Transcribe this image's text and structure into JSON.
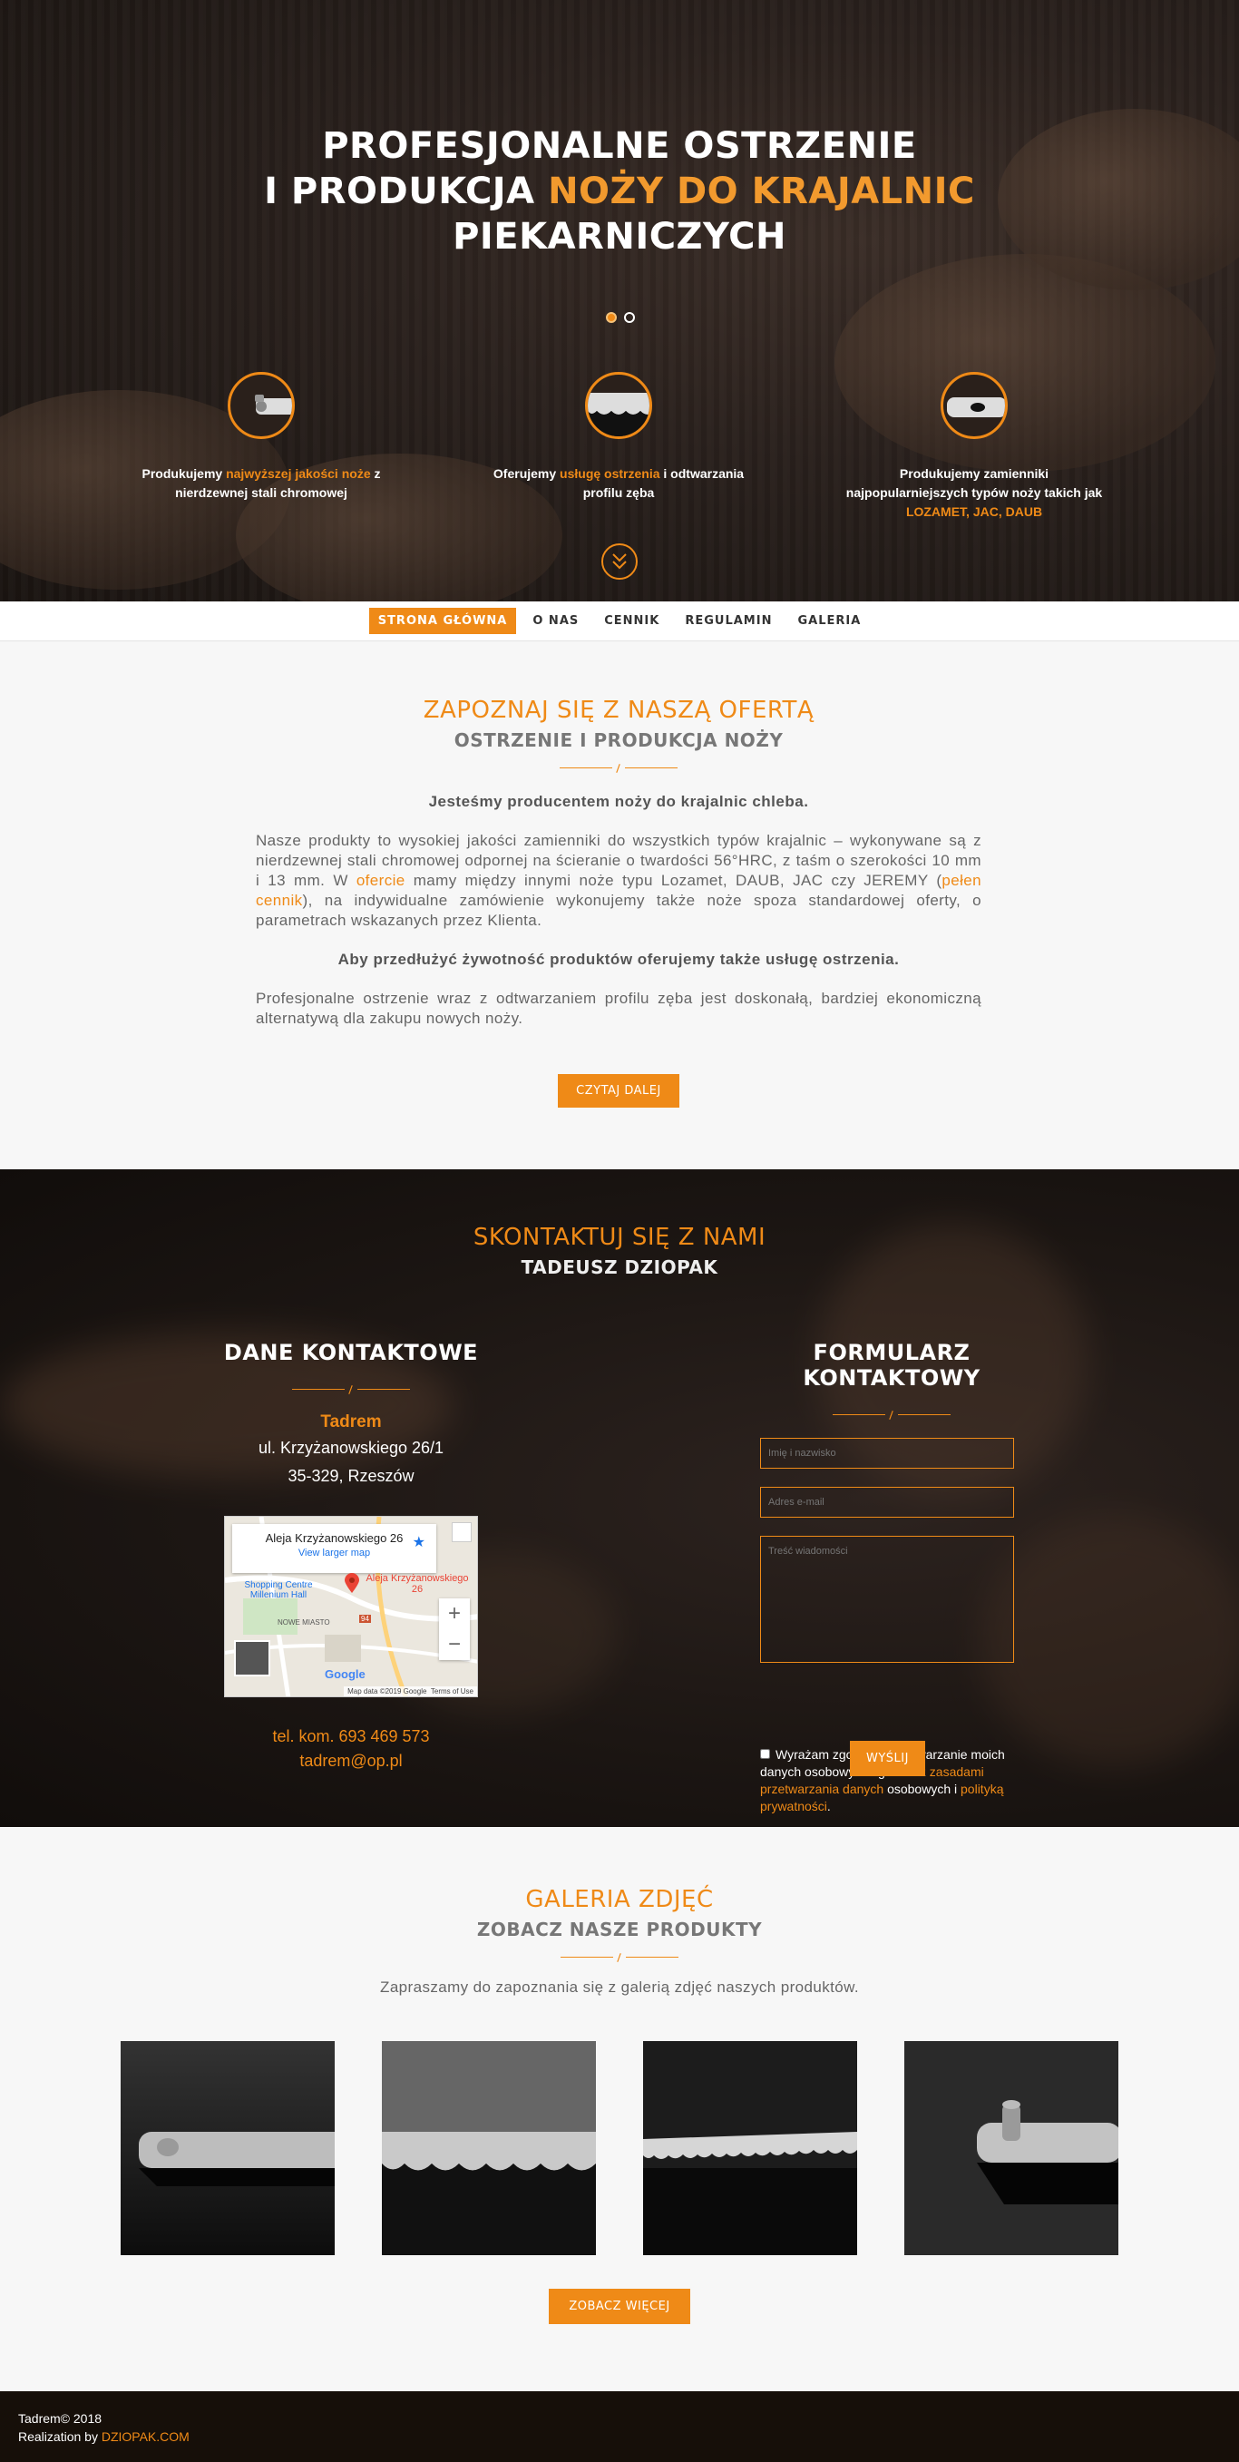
{
  "hero": {
    "title_line1": "PROFESJONALNE OSTRZENIE",
    "title_line2_prefix": "I PRODUKCJA ",
    "title_line2_highlight": "NOŻY DO KRAJALNIC",
    "title_line3": "PIEKARNICZYCH",
    "slide_count": 2,
    "active_slide": 1,
    "features": [
      {
        "icon": "knife-holder-icon",
        "pre": "Produkujemy ",
        "hl": "najwyższej jakości noże",
        "post": " z nierdzewnej stali chromowej"
      },
      {
        "icon": "serrated-blade-icon",
        "pre": "Oferujemy ",
        "hl": "usługę ostrzenia",
        "post": " i odtwarzania profilu zęba"
      },
      {
        "icon": "blade-hole-icon",
        "pre": "Produkujemy zamienniki najpopularniejszych typów noży takich jak ",
        "hl": "LOZAMET, JAC, DAUB",
        "post": ""
      }
    ]
  },
  "nav": {
    "items": [
      "STRONA GŁÓWNA",
      "O NAS",
      "CENNIK",
      "REGULAMIN",
      "GALERIA"
    ],
    "active_index": 0
  },
  "offer": {
    "title": "ZAPOZNAJ SIĘ Z NASZĄ OFERTĄ",
    "subtitle": "OSTRZENIE I PRODUKCJA NOŻY",
    "lead": "Jesteśmy producentem noży do krajalnic chleba.",
    "p1_a": "Nasze produkty to wysokiej jakości zamienniki do wszystkich typów krajalnic – wykonywane są z nierdzewnej stali chromowej odpornej na ścieranie o twardości 56°HRC, z taśm o szerokości 10 mm i 13 mm. W ",
    "p1_link1": "ofercie",
    "p1_b": " mamy między innymi noże typu Lozamet, DAUB, JAC czy JEREMY (",
    "p1_link2": "pełen cennik",
    "p1_c": "), na indywidualne zamówienie wykonujemy także noże spoza standardowej oferty, o parametrach wskazanych przez Klienta.",
    "lead2": "Aby przedłużyć żywotność produktów oferujemy także usługę ostrzenia.",
    "p2": "Profesjonalne ostrzenie wraz z odtwarzaniem profilu zęba jest doskonałą, bardziej ekonomiczną alternatywą dla zakupu nowych noży.",
    "button": "CZYTAJ DALEJ"
  },
  "contact": {
    "title": "SKONTAKTUJ SIĘ Z NAMI",
    "subtitle": "TADEUSZ DZIOPAK",
    "left_title": "DANE KONTAKTOWE",
    "company": "Tadrem",
    "street": "ul. Krzyżanowskiego 26/1",
    "city": "35-329, Rzeszów",
    "map": {
      "place": "Aleja Krzyżanowskiego 26",
      "larger": "View larger map",
      "pin_label": "Aleja Krzyżanowskiego 26",
      "poi1": "Shopping Centre Millenium Hall",
      "district": "NOWE MIASTO",
      "road": "94",
      "footer1": "Map data ©2019 Google",
      "footer2": "Terms of Use",
      "logo": "Google"
    },
    "phone": "tel. kom. 693 469 573",
    "email": "tadrem@op.pl",
    "right_title": "FORMULARZ KONTAKTOWY",
    "name_placeholder": "Imię i nazwisko",
    "email_placeholder": "Adres e-mail",
    "message_placeholder": "Treść wiadomości",
    "consent_a": "Wyrażam zgodę na przetwarzanie moich danych osobowych zgodnie z ",
    "consent_link1": "zasadami przetwarzania danych",
    "consent_b": " osobowych i ",
    "consent_link2": "polityką prywatności",
    "consent_c": ".",
    "submit": "WYŚLIJ"
  },
  "gallery": {
    "title": "GALERIA ZDJĘĆ",
    "subtitle": "ZOBACZ NASZE PRODUKTY",
    "text": "Zapraszamy do zapoznania się z galerią zdjęć naszych produktów.",
    "button": "ZOBACZ WIĘCEJ"
  },
  "footer": {
    "copyright": "Tadrem© 2018",
    "realization": "Realization by ",
    "realization_link": "DZIOPAK.COM"
  },
  "colors": {
    "accent": "#ef8a17",
    "dark": "#1c1613",
    "footer": "#160f09"
  }
}
